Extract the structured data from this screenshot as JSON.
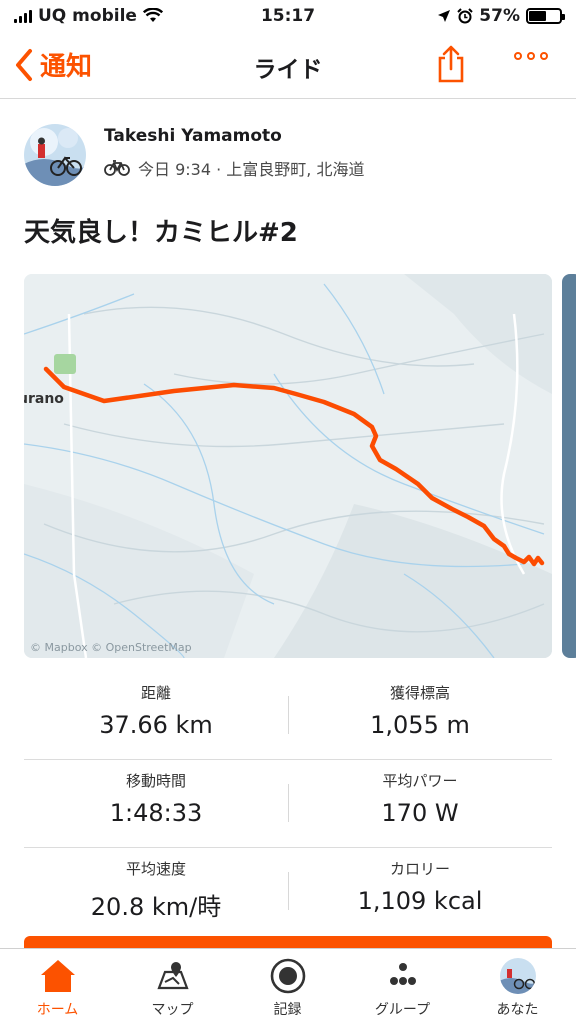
{
  "status_bar": {
    "carrier": "UQ mobile",
    "time": "15:17",
    "battery": "57%",
    "battery_level": 0.57
  },
  "nav": {
    "back_label": "通知",
    "title": "ライド"
  },
  "activity": {
    "athlete": "Takeshi Yamamoto",
    "meta": "今日 9:34 · 上富良野町, 北海道",
    "title": "天気良し！カミヒル#2"
  },
  "map": {
    "place_label": "urano",
    "attribution": "© Mapbox © OpenStreetMap"
  },
  "stats": [
    {
      "left": {
        "label": "距離",
        "value": "37.66 km"
      },
      "right": {
        "label": "獲得標高",
        "value": "1,055 m"
      }
    },
    {
      "left": {
        "label": "移動時間",
        "value": "1:48:33"
      },
      "right": {
        "label": "平均パワー",
        "value": "170 W"
      }
    },
    {
      "left": {
        "label": "平均速度",
        "value": "20.8 km/時"
      },
      "right": {
        "label": "カロリー",
        "value": "1,109 kcal"
      }
    }
  ],
  "tabs": [
    {
      "label": "ホーム",
      "icon": "home-icon",
      "active": true
    },
    {
      "label": "マップ",
      "icon": "map-icon",
      "active": false
    },
    {
      "label": "記録",
      "icon": "record-icon",
      "active": false
    },
    {
      "label": "グループ",
      "icon": "group-icon",
      "active": false
    },
    {
      "label": "あなた",
      "icon": "avatar-icon",
      "active": false
    }
  ],
  "colors": {
    "accent": "#fc5200",
    "route": "#fc4c02",
    "map_bg": "#e8eef0"
  }
}
